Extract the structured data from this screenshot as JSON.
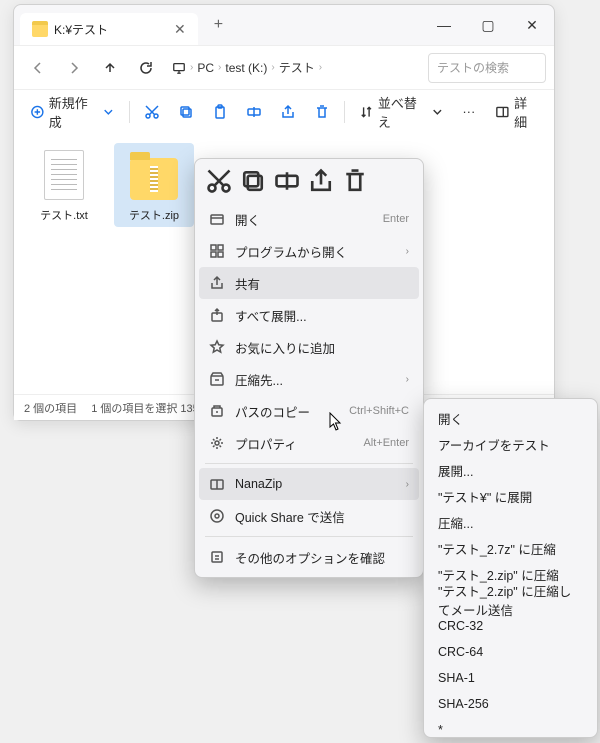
{
  "window": {
    "title": "K:¥テスト",
    "controls": {
      "min": "—",
      "max": "▢",
      "close": "✕"
    },
    "tab_add": "+"
  },
  "nav": {
    "back": "←",
    "forward": "→",
    "up": "↑",
    "refresh": "⟳"
  },
  "breadcrumb": {
    "items": [
      "PC",
      "test (K:)",
      "テスト"
    ]
  },
  "search": {
    "placeholder": "テストの検索"
  },
  "toolbar": {
    "new": "新規作成",
    "sort": "並べ替え",
    "more": "···",
    "details": "詳細"
  },
  "files": [
    {
      "name": "テスト.txt",
      "selected": false,
      "type": "doc"
    },
    {
      "name": "テスト.zip",
      "selected": true,
      "type": "zip"
    }
  ],
  "status": {
    "count": "2 個の項目",
    "selection": "1 個の項目を選択 135 バ"
  },
  "context_menu": {
    "items": [
      {
        "icon": "open",
        "label": "開く",
        "hint": "Enter"
      },
      {
        "icon": "openwith",
        "label": "プログラムから開く",
        "arrow": true
      },
      {
        "icon": "share",
        "label": "共有",
        "hover": true
      },
      {
        "icon": "extract",
        "label": "すべて展開..."
      },
      {
        "icon": "star",
        "label": "お気に入りに追加"
      },
      {
        "icon": "archive",
        "label": "圧縮先...",
        "arrow": true
      },
      {
        "icon": "copypath",
        "label": "パスのコピー",
        "hint": "Ctrl+Shift+C"
      },
      {
        "icon": "props",
        "label": "プロパティ",
        "hint": "Alt+Enter"
      },
      {
        "sep": true
      },
      {
        "icon": "nanazip",
        "label": "NanaZip",
        "arrow": true,
        "hover": true
      },
      {
        "icon": "qshare",
        "label": "Quick Share で送信"
      },
      {
        "sep": true
      },
      {
        "icon": "more",
        "label": "その他のオプションを確認"
      }
    ]
  },
  "submenu": {
    "items": [
      "開く",
      "アーカイブをテスト",
      "展開...",
      "\"テスト¥\" に展開",
      "圧縮...",
      "\"テスト_2.7z\" に圧縮",
      "\"テスト_2.zip\" に圧縮",
      "\"テスト_2.zip\" に圧縮してメール送信",
      "CRC-32",
      "CRC-64",
      "SHA-1",
      "SHA-256",
      "*"
    ]
  }
}
